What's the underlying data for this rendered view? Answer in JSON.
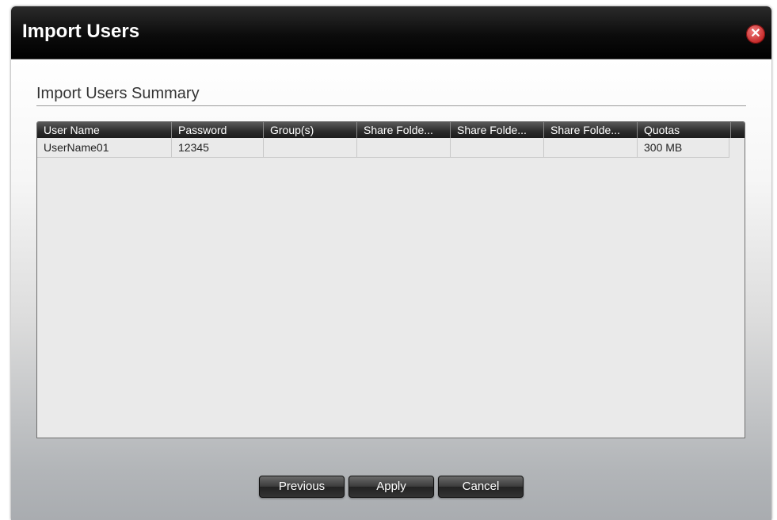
{
  "dialog": {
    "title": "Import Users",
    "close_icon": "close-icon"
  },
  "summary": {
    "title": "Import Users Summary"
  },
  "table": {
    "columns": [
      "User Name",
      "Password",
      "Group(s)",
      "Share Folde...",
      "Share Folde...",
      "Share Folde...",
      "Quotas"
    ],
    "rows": [
      [
        "UserName01",
        "12345",
        "",
        "",
        "",
        "",
        "300 MB"
      ]
    ]
  },
  "buttons": {
    "previous": "Previous",
    "apply": "Apply",
    "cancel": "Cancel"
  }
}
